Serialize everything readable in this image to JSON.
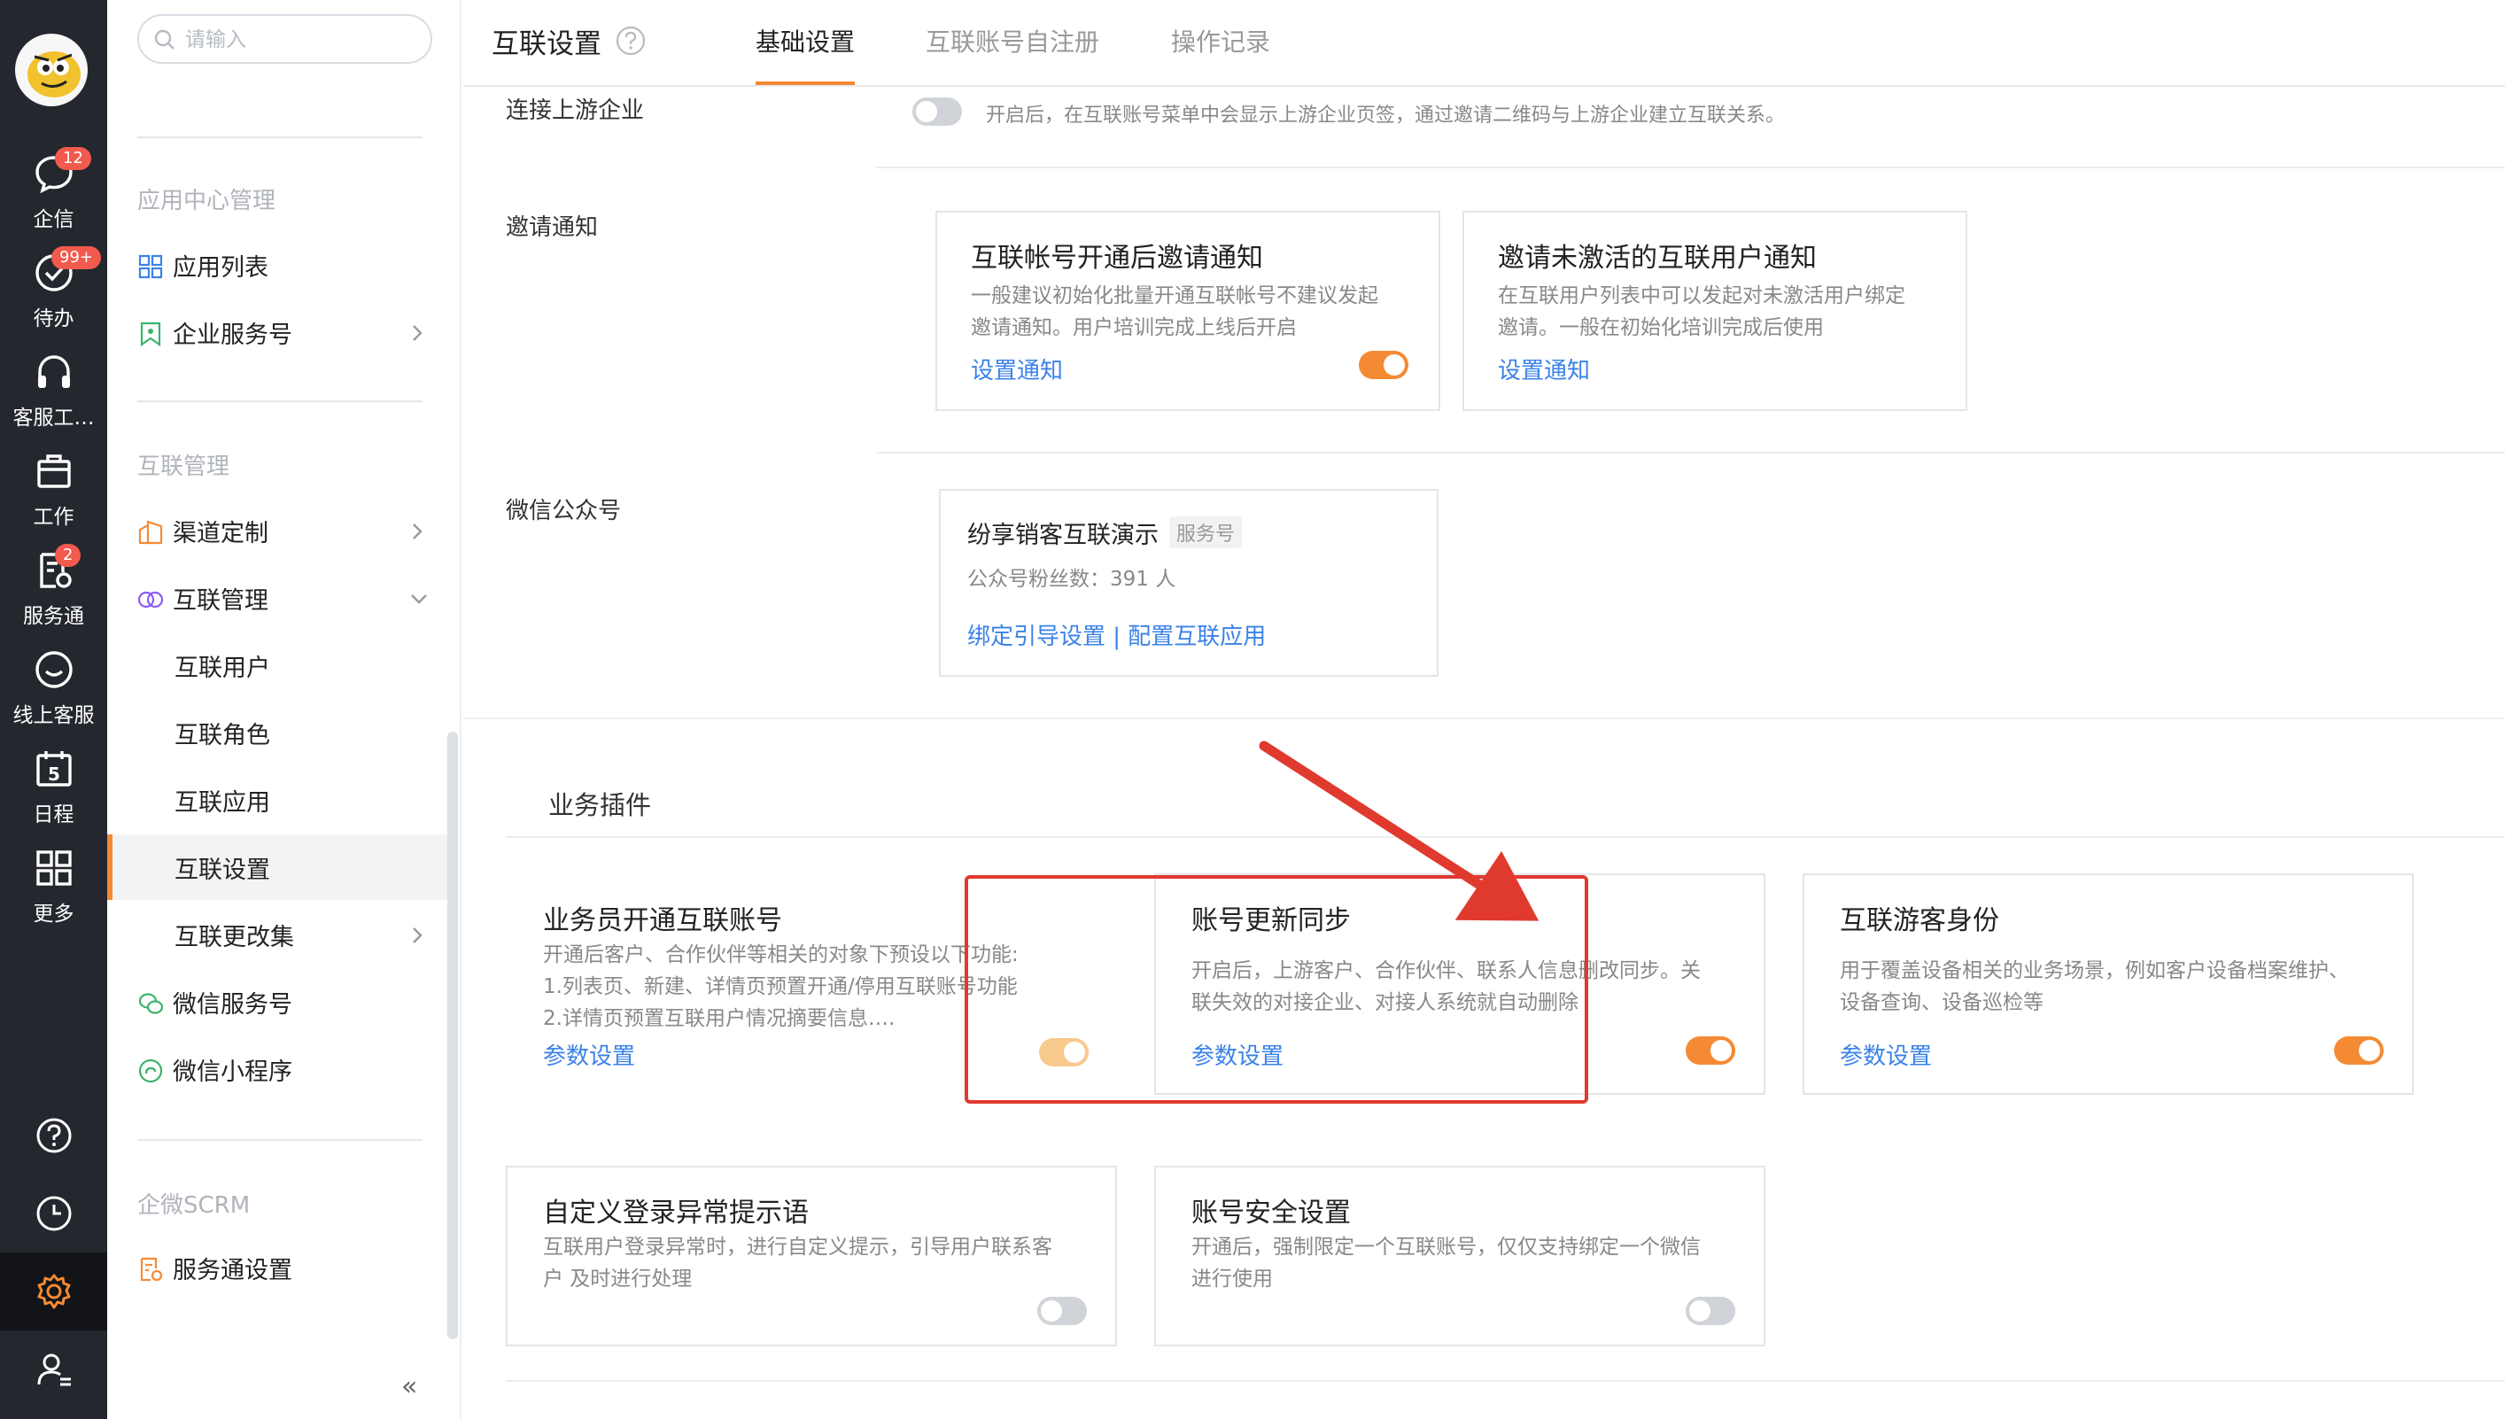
{
  "rail": {
    "items": [
      {
        "label": "企信",
        "badge": "12"
      },
      {
        "label": "待办",
        "badge": "99+"
      },
      {
        "label": "客服工…"
      },
      {
        "label": "工作"
      },
      {
        "label": "服务通",
        "badge": "2"
      },
      {
        "label": "线上客服"
      },
      {
        "label": "日程",
        "calendar_day": "5"
      },
      {
        "label": "更多"
      }
    ]
  },
  "subnav": {
    "search_placeholder": "请输入",
    "groups": [
      {
        "title": "应用中心管理",
        "items": [
          "应用列表",
          "企业服务号"
        ]
      },
      {
        "title": "互联管理",
        "items": [
          "渠道定制",
          "互联管理",
          "互联用户",
          "互联角色",
          "互联应用",
          "互联设置",
          "互联更改集",
          "微信服务号",
          "微信小程序"
        ]
      },
      {
        "title": "企微SCRM",
        "items": [
          "服务通设置"
        ]
      }
    ],
    "active": "互联设置",
    "collapse_glyph": "«"
  },
  "header": {
    "title": "互联设置",
    "tabs": [
      "基础设置",
      "互联账号自注册",
      "操作记录"
    ],
    "active_tab": "基础设置"
  },
  "settings": {
    "upstream": {
      "label": "连接上游企业",
      "hint": "开启后，在互联账号菜单中会显示上游企业页签，通过邀请二维码与上游企业建立互联关系。",
      "enabled": false
    },
    "invite": {
      "label": "邀请通知",
      "cards": [
        {
          "title": "互联帐号开通后邀请通知",
          "desc1": "一般建议初始化批量开通互联帐号不建议发起",
          "desc2": "邀请通知。用户培训完成上线后开启",
          "link": "设置通知",
          "enabled": true
        },
        {
          "title": "邀请未激活的互联用户通知",
          "desc1": "在互联用户列表中可以发起对未激活用户绑定",
          "desc2": "邀请。一般在初始化培训完成后使用",
          "link": "设置通知"
        }
      ]
    },
    "wechat": {
      "label": "微信公众号",
      "name": "纷享销客互联演示",
      "tag": "服务号",
      "fans": "公众号粉丝数：391 人",
      "links": "绑定引导设置 | 配置互联应用"
    }
  },
  "plugins": {
    "section_title": "业务插件",
    "cards": [
      {
        "title": "业务员开通互联账号",
        "lines": [
          "开通后客户、合作伙伴等相关的对象下预设以下功能:",
          "1.列表页、新建、详情页预置开通/停用互联账号功能",
          "2.详情页预置互联用户情况摘要信息…."
        ],
        "link": "参数设置",
        "enabled": true
      },
      {
        "title": "账号更新同步",
        "lines": [
          "开启后，上游客户、合作伙伴、联系人信息删改同步。关",
          "联失效的对接企业、对接人系统就自动删除"
        ],
        "link": "参数设置",
        "enabled": true
      },
      {
        "title": "互联游客身份",
        "lines": [
          "用于覆盖设备相关的业务场景，例如客户设备档案维护、",
          "设备查询、设备巡检等"
        ],
        "link": "参数设置",
        "enabled": true
      },
      {
        "title": "自定义登录异常提示语",
        "lines": [
          "互联用户登录异常时，进行自定义提示，引导用户联系客",
          "户 及时进行处理"
        ],
        "enabled": false
      },
      {
        "title": "账号安全设置",
        "lines": [
          "开通后，强制限定一个互联账号，仅仅支持绑定一个微信",
          "进行使用"
        ],
        "enabled": false
      }
    ]
  },
  "colors": {
    "accent": "#f58a34",
    "link": "#3a82e8",
    "highlight": "#e03a2f",
    "rail_bg": "#24272e"
  }
}
